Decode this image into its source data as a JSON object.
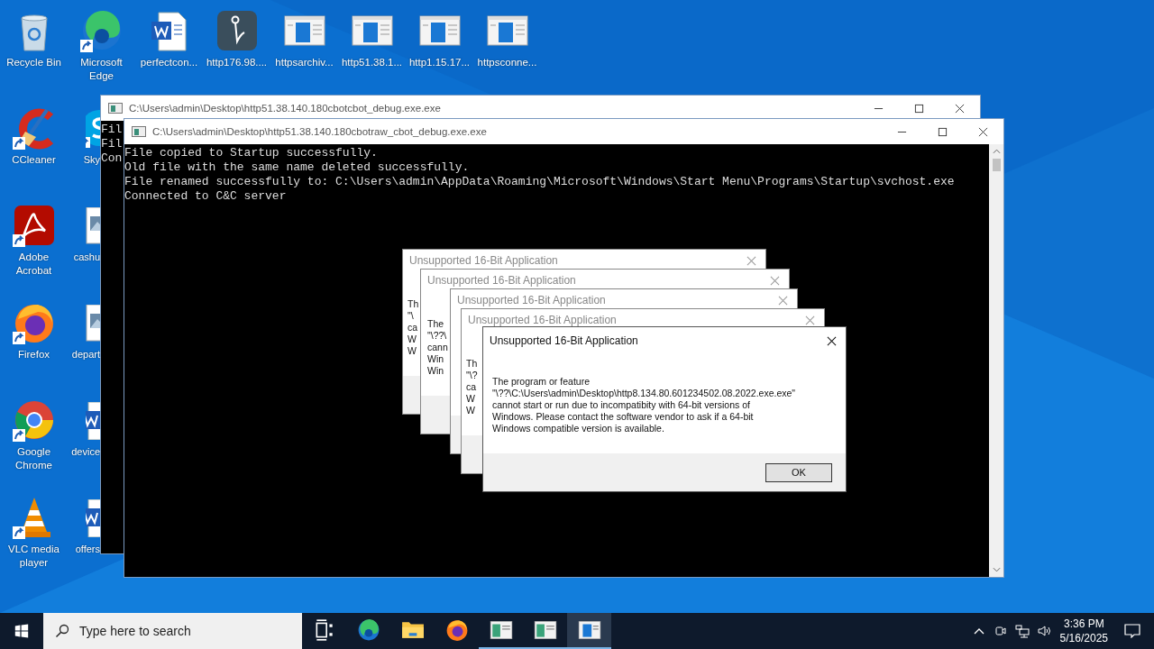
{
  "desktop_columns": [
    [
      {
        "label": "Recycle Bin",
        "kind": "recycle",
        "shortcut": false,
        "clipped": false
      },
      {
        "label": "CCleaner",
        "kind": "ccleaner",
        "shortcut": true,
        "clipped": false
      },
      {
        "label": "Adobe Acrobat",
        "kind": "acrobat",
        "shortcut": true,
        "clipped": false
      },
      {
        "label": "Firefox",
        "kind": "firefox",
        "shortcut": true,
        "clipped": false
      },
      {
        "label": "Google Chrome",
        "kind": "chrome",
        "shortcut": true,
        "clipped": false
      },
      {
        "label": "VLC media player",
        "kind": "vlc",
        "shortcut": true,
        "clipped": false
      }
    ],
    [
      {
        "label": "Microsoft Edge",
        "kind": "edge",
        "shortcut": true,
        "clipped": false
      },
      {
        "label": "Sky",
        "kind": "skype",
        "shortcut": true,
        "clipped": true
      },
      {
        "label": "cashu",
        "kind": "image",
        "shortcut": false,
        "clipped": true
      },
      {
        "label": "depart",
        "kind": "image",
        "shortcut": false,
        "clipped": true
      },
      {
        "label": "device",
        "kind": "word",
        "shortcut": false,
        "clipped": true
      },
      {
        "label": "offers",
        "kind": "word",
        "shortcut": false,
        "clipped": true
      }
    ],
    [
      {
        "label": "perfectcon...",
        "kind": "word",
        "shortcut": false,
        "clipped": false
      }
    ],
    [
      {
        "label": "http176.98....",
        "kind": "app",
        "shortcut": false,
        "clipped": false
      }
    ],
    [
      {
        "label": "httpsarchiv...",
        "kind": "window",
        "shortcut": false,
        "clipped": false
      }
    ],
    [
      {
        "label": "http51.38.1...",
        "kind": "window",
        "shortcut": false,
        "clipped": false
      }
    ],
    [
      {
        "label": "http1.15.17...",
        "kind": "window",
        "shortcut": false,
        "clipped": false
      }
    ],
    [
      {
        "label": "httpsconne...",
        "kind": "window",
        "shortcut": false,
        "clipped": false
      }
    ]
  ],
  "consoles": [
    {
      "title": "C:\\Users\\admin\\Desktop\\http51.38.140.180cbotcbot_debug.exe.exe",
      "lines": [
        "Fil",
        "Fil",
        "Con"
      ]
    },
    {
      "title": "C:\\Users\\admin\\Desktop\\http51.38.140.180cbotraw_cbot_debug.exe.exe",
      "lines": [
        "File copied to Startup successfully.",
        "Old file with the same name deleted successfully.",
        "File renamed successfully to: C:\\Users\\admin\\AppData\\Roaming\\Microsoft\\Windows\\Start Menu\\Programs\\Startup\\svchost.exe",
        "Connected to C&C server"
      ]
    }
  ],
  "dialogs": [
    {
      "title": "Unsupported 16-Bit Application",
      "active": false,
      "message": "Th\n\"\\\nca\nW\nW"
    },
    {
      "title": "Unsupported 16-Bit Application",
      "active": false,
      "message": "The\n\"\\??\\\ncann\nWin\nWin"
    },
    {
      "title": "Unsupported 16-Bit Application",
      "active": false
    },
    {
      "title": "Unsupported 16-Bit Application",
      "active": false,
      "message": "Th\n\"\\?\nca\nW\nW"
    },
    {
      "title": "Unsupported 16-Bit Application",
      "active": true,
      "message": "The program or feature\n\"\\??\\C:\\Users\\admin\\Desktop\\http8.134.80.601234502.08.2022.exe.exe\"\ncannot start or run due to incompatibity with 64-bit versions of\nWindows. Please contact the software vendor to ask if a 64-bit\nWindows compatible version is available.",
      "button": "OK"
    }
  ],
  "taskbar": {
    "search": {
      "placeholder": "Type here to search"
    },
    "apps": [
      {
        "kind": "taskview",
        "running": false,
        "selected": false
      },
      {
        "kind": "edge",
        "running": false,
        "selected": false
      },
      {
        "kind": "folder",
        "running": false,
        "selected": false
      },
      {
        "kind": "firefox",
        "running": false,
        "selected": false
      },
      {
        "kind": "console",
        "running": true,
        "selected": false
      },
      {
        "kind": "console",
        "running": true,
        "selected": false
      },
      {
        "kind": "console2",
        "running": true,
        "selected": true
      }
    ],
    "time": "3:36 PM",
    "date": "5/16/2025"
  }
}
